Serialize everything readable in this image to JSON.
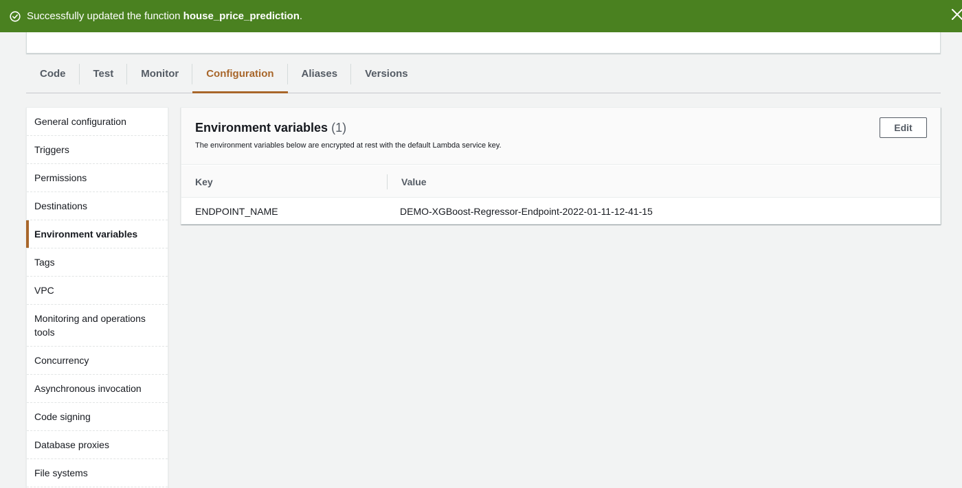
{
  "flash": {
    "message_prefix": "Successfully updated the function ",
    "function_name": "house_price_prediction",
    "message_suffix": ".",
    "status_color": "#4a8120"
  },
  "tabs": [
    {
      "label": "Code",
      "active": false
    },
    {
      "label": "Test",
      "active": false
    },
    {
      "label": "Monitor",
      "active": false
    },
    {
      "label": "Configuration",
      "active": true
    },
    {
      "label": "Aliases",
      "active": false
    },
    {
      "label": "Versions",
      "active": false
    }
  ],
  "sidenav": {
    "items": [
      {
        "label": "General configuration",
        "active": false
      },
      {
        "label": "Triggers",
        "active": false
      },
      {
        "label": "Permissions",
        "active": false
      },
      {
        "label": "Destinations",
        "active": false
      },
      {
        "label": "Environment variables",
        "active": true
      },
      {
        "label": "Tags",
        "active": false
      },
      {
        "label": "VPC",
        "active": false
      },
      {
        "label": "Monitoring and operations tools",
        "active": false
      },
      {
        "label": "Concurrency",
        "active": false
      },
      {
        "label": "Asynchronous invocation",
        "active": false
      },
      {
        "label": "Code signing",
        "active": false
      },
      {
        "label": "Database proxies",
        "active": false
      },
      {
        "label": "File systems",
        "active": false
      }
    ]
  },
  "env_panel": {
    "title": "Environment variables",
    "count": "(1)",
    "description": "The environment variables below are encrypted at rest with the default Lambda service key.",
    "edit_label": "Edit",
    "columns": {
      "key": "Key",
      "value": "Value"
    },
    "rows": [
      {
        "key": "ENDPOINT_NAME",
        "value": "DEMO-XGBoost-Regressor-Endpoint-2022-01-11-12-41-15"
      }
    ]
  },
  "colors": {
    "accent": "#a8662a",
    "background": "#f2f3f3"
  }
}
